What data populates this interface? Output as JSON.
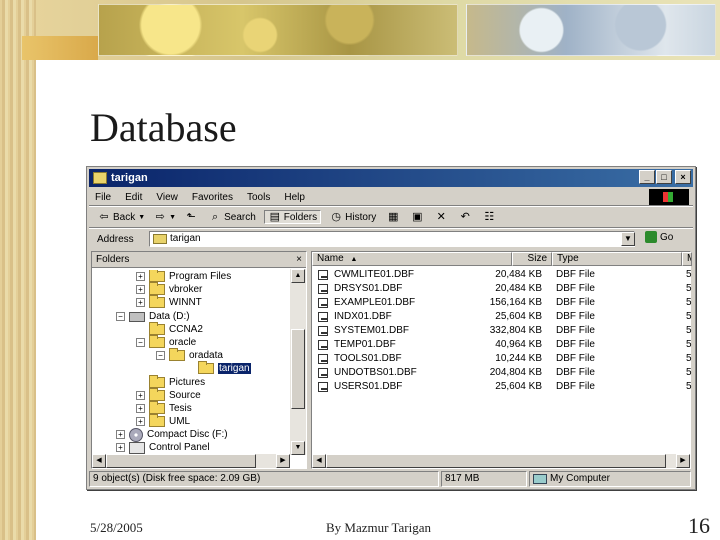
{
  "slide": {
    "title": "Database",
    "footer_date": "5/28/2005",
    "footer_author": "By Mazmur Tarigan",
    "page_number": "16"
  },
  "window": {
    "title": "tarigan",
    "buttons": {
      "minimize": "_",
      "maximize": "□",
      "close": "×"
    },
    "menu": [
      "File",
      "Edit",
      "View",
      "Favorites",
      "Tools",
      "Help"
    ],
    "toolbar": {
      "back": "Back",
      "forward_icon": "forward-arrow-icon",
      "up_icon": "up-folder-icon",
      "search": "Search",
      "folders": "Folders",
      "history": "History"
    },
    "address": {
      "label": "Address",
      "value": "tarigan",
      "go": "Go"
    }
  },
  "folders_pane": {
    "title": "Folders",
    "close": "×",
    "items": [
      {
        "label": "Program Files",
        "type": "folder",
        "toggle": "+"
      },
      {
        "label": "vbroker",
        "type": "folder",
        "toggle": "+"
      },
      {
        "label": "WINNT",
        "type": "folder",
        "toggle": "+"
      },
      {
        "label": "Data (D:)",
        "type": "drive",
        "toggle": "−"
      },
      {
        "label": "CCNA2",
        "type": "folder",
        "toggle": ""
      },
      {
        "label": "oracle",
        "type": "folder",
        "toggle": "−"
      },
      {
        "label": "oradata",
        "type": "folder",
        "toggle": "−"
      },
      {
        "label": "tarigan",
        "type": "folder",
        "toggle": "",
        "selected": true
      },
      {
        "label": "Pictures",
        "type": "folder",
        "toggle": ""
      },
      {
        "label": "Source",
        "type": "folder",
        "toggle": "+"
      },
      {
        "label": "Tesis",
        "type": "folder",
        "toggle": "+"
      },
      {
        "label": "UML",
        "type": "folder",
        "toggle": "+"
      },
      {
        "label": "Compact Disc (F:)",
        "type": "cd",
        "toggle": "+"
      },
      {
        "label": "Control Panel",
        "type": "cp",
        "toggle": "+"
      }
    ]
  },
  "files_pane": {
    "columns": {
      "name": "Name",
      "size": "Size",
      "type": "Type",
      "modified": "M"
    },
    "rows": [
      {
        "name": "CWMLITE01.DBF",
        "size": "20,484 KB",
        "type": "DBF File",
        "mod": "5"
      },
      {
        "name": "DRSYS01.DBF",
        "size": "20,484 KB",
        "type": "DBF File",
        "mod": "5"
      },
      {
        "name": "EXAMPLE01.DBF",
        "size": "156,164 KB",
        "type": "DBF File",
        "mod": "5"
      },
      {
        "name": "INDX01.DBF",
        "size": "25,604 KB",
        "type": "DBF File",
        "mod": "5"
      },
      {
        "name": "SYSTEM01.DBF",
        "size": "332,804 KB",
        "type": "DBF File",
        "mod": "5"
      },
      {
        "name": "TEMP01.DBF",
        "size": "40,964 KB",
        "type": "DBF File",
        "mod": "5"
      },
      {
        "name": "TOOLS01.DBF",
        "size": "10,244 KB",
        "type": "DBF File",
        "mod": "5"
      },
      {
        "name": "UNDOTBS01.DBF",
        "size": "204,804 KB",
        "type": "DBF File",
        "mod": "5"
      },
      {
        "name": "USERS01.DBF",
        "size": "25,604 KB",
        "type": "DBF File",
        "mod": "5"
      }
    ]
  },
  "status": {
    "summary": "9 object(s) (Disk free space: 2.09 GB)",
    "size": "817 MB",
    "location": "My Computer"
  },
  "colors": {
    "titlebar": "#0a246a",
    "selection": "#0a246a",
    "folder": "#f4d65c"
  }
}
